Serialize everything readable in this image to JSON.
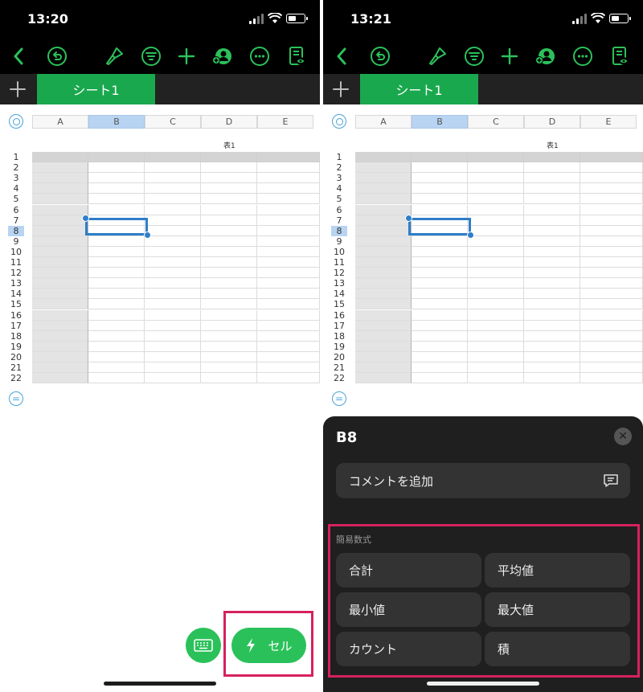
{
  "left": {
    "status": {
      "time": "13:20"
    },
    "tab": {
      "add": "+",
      "sheet_name": "シート1"
    },
    "grid": {
      "columns": [
        "A",
        "B",
        "C",
        "D",
        "E"
      ],
      "selected_column": "B",
      "table_title": "表1",
      "rows": [
        "1",
        "2",
        "3",
        "4",
        "5",
        "6",
        "7",
        "8",
        "9",
        "10",
        "11",
        "12",
        "13",
        "14",
        "15",
        "16",
        "17",
        "18",
        "19",
        "20",
        "21",
        "22"
      ],
      "selected_row": "8"
    },
    "fab": {
      "keyboard_icon": "keyboard-icon",
      "cell_label": "セル",
      "cell_icon": "lightning-icon"
    }
  },
  "right": {
    "status": {
      "time": "13:21"
    },
    "tab": {
      "add": "+",
      "sheet_name": "シート1"
    },
    "grid": {
      "columns": [
        "A",
        "B",
        "C",
        "D",
        "E"
      ],
      "selected_column": "B",
      "table_title": "表1",
      "rows": [
        "1",
        "2",
        "3",
        "4",
        "5",
        "6",
        "7",
        "8",
        "9",
        "10",
        "11",
        "12",
        "13",
        "14",
        "15",
        "16",
        "17",
        "18",
        "19",
        "20",
        "21",
        "22"
      ],
      "selected_row": "8"
    },
    "sheet": {
      "title": "B8",
      "close": "✕",
      "add_comment": "コメントを追加",
      "quick_formulas_label": "簡易数式",
      "formulas": [
        "合計",
        "平均値",
        "最小値",
        "最大値",
        "カウント",
        "積"
      ]
    }
  },
  "colors": {
    "accent_green": "#2bc15a",
    "tab_green": "#1aa84e",
    "selection_blue": "#2f7ec9",
    "highlight_pink": "#d5215f",
    "sheet_dark": "#1f1f1f"
  }
}
